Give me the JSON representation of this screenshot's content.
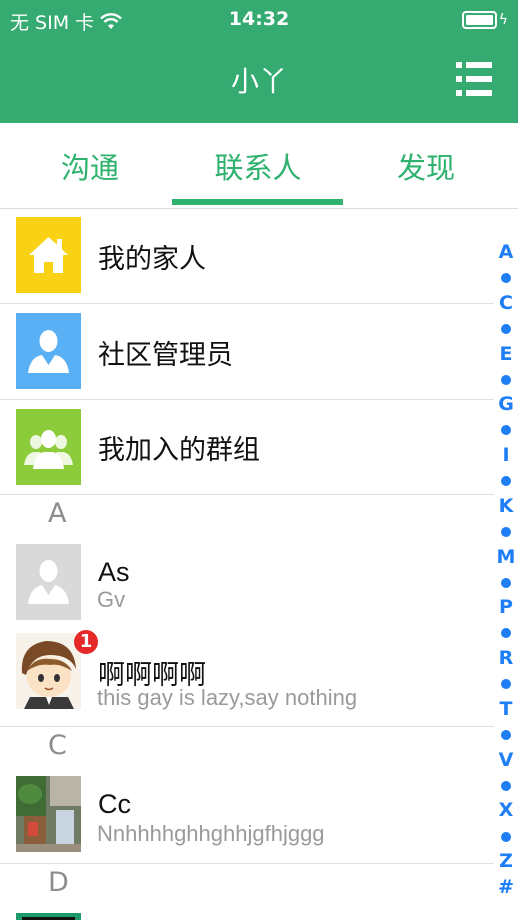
{
  "status_bar": {
    "carrier": "无 SIM 卡",
    "time": "14:32"
  },
  "header": {
    "title": "小丫"
  },
  "tabs": [
    {
      "label": "沟通",
      "active": false
    },
    {
      "label": "联系人",
      "active": true
    },
    {
      "label": "发现",
      "active": false
    }
  ],
  "groups": [
    {
      "label": "我的家人",
      "icon": "home-icon",
      "color": "#f9d215"
    },
    {
      "label": "社区管理员",
      "icon": "admin-person-icon",
      "color": "#5ab0f4"
    },
    {
      "label": "我加入的群组",
      "icon": "group-icon",
      "color": "#8ccc3a"
    }
  ],
  "sections": [
    {
      "letter": "A",
      "contacts": [
        {
          "name": "As",
          "status": "Gv",
          "avatar": "default-avatar-icon"
        },
        {
          "name": "啊啊啊啊",
          "status": "this gay is lazy,say nothing",
          "avatar": "cartoon-avatar",
          "badge": "1"
        }
      ]
    },
    {
      "letter": "C",
      "contacts": [
        {
          "name": "Cc",
          "status": "Nnhhhhghhghhjgfhjggg",
          "avatar": "photo-avatar"
        }
      ]
    },
    {
      "letter": "D",
      "contacts": []
    }
  ],
  "index_bar": [
    "A",
    "•",
    "C",
    "•",
    "E",
    "•",
    "G",
    "•",
    "I",
    "•",
    "K",
    "•",
    "M",
    "•",
    "P",
    "•",
    "R",
    "•",
    "T",
    "•",
    "V",
    "•",
    "X",
    "•",
    "Z",
    "#"
  ],
  "colors": {
    "brand_green": "#35ab72",
    "tab_green": "#2eb26d",
    "index_blue": "#1d7ef5",
    "badge_red": "#e62a2a"
  }
}
